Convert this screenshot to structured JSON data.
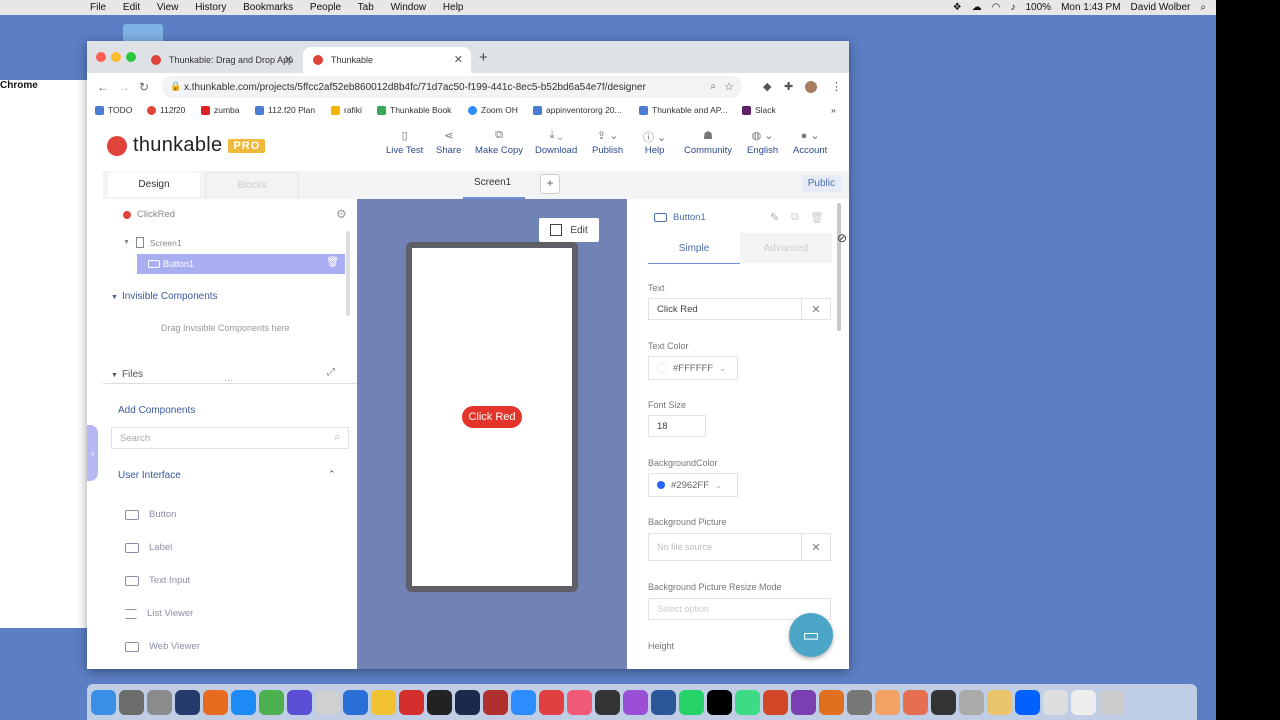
{
  "menubar": {
    "app_name": "Chrome",
    "menus": [
      "File",
      "Edit",
      "View",
      "History",
      "Bookmarks",
      "People",
      "Tab",
      "Window",
      "Help"
    ],
    "battery": "100%",
    "clock": "Mon 1:43 PM",
    "user": "David Wolber"
  },
  "browser": {
    "tabs": [
      {
        "title": "Thunkable: Drag and Drop App",
        "active": false
      },
      {
        "title": "Thunkable",
        "active": true
      }
    ],
    "url": "x.thunkable.com/projects/5ffcc2af52eb860012d8b4fc/71d7ac50-f199-441c-8ec5-b52bd6a54e7f/designer",
    "bookmarks": [
      "TODO",
      "112f20",
      "zumba",
      "112.f20 Plan",
      "rafiki",
      "Thunkable Book",
      "Zoom OH",
      "appinventororg 20...",
      "Thunkable and AP...",
      "Slack"
    ],
    "more": "»"
  },
  "header": {
    "brand": "thunkable",
    "badge": "PRO",
    "nav": [
      {
        "label": "Live Test",
        "icon": "phone-icon"
      },
      {
        "label": "Share",
        "icon": "share-icon"
      },
      {
        "label": "Make Copy",
        "icon": "copy-icon"
      },
      {
        "label": "Download",
        "icon": "download-icon"
      },
      {
        "label": "Publish",
        "icon": "publish-icon"
      },
      {
        "label": "Help",
        "icon": "help-icon"
      },
      {
        "label": "Community",
        "icon": "community-icon"
      },
      {
        "label": "English",
        "icon": "globe-icon"
      },
      {
        "label": "Account",
        "icon": "avatar-icon"
      }
    ]
  },
  "designer_tabs": {
    "design": "Design",
    "blocks": "Blocks",
    "screen": "Screen1",
    "add": "+",
    "visibility": "Public"
  },
  "tree": {
    "project": "ClickRed",
    "screen": "Screen1",
    "selected": "Button1",
    "invisible_header": "Invisible Components",
    "invisible_hint": "Drag Invisible Components here",
    "files_header": "Files"
  },
  "components": {
    "header": "Add Components",
    "search_placeholder": "Search",
    "group": "User Interface",
    "items": [
      "Button",
      "Label",
      "Text Input",
      "List Viewer",
      "Web Viewer"
    ]
  },
  "canvas": {
    "edit_label": "Edit",
    "button_text": "Click Red",
    "button_color": "#e2342a"
  },
  "properties": {
    "component": "Button1",
    "tab_simple": "Simple",
    "tab_advanced": "Advanced",
    "text_label": "Text",
    "text_value": "Click Red",
    "text_color_label": "Text Color",
    "text_color_value": "#FFFFFF",
    "font_size_label": "Font Size",
    "font_size_value": "18",
    "bg_color_label": "BackgroundColor",
    "bg_color_value": "#2962FF",
    "bg_picture_label": "Background Picture",
    "bg_picture_value": "No file source",
    "resize_label": "Background Picture Resize Mode",
    "resize_placeholder": "Select option",
    "height_label": "Height"
  }
}
